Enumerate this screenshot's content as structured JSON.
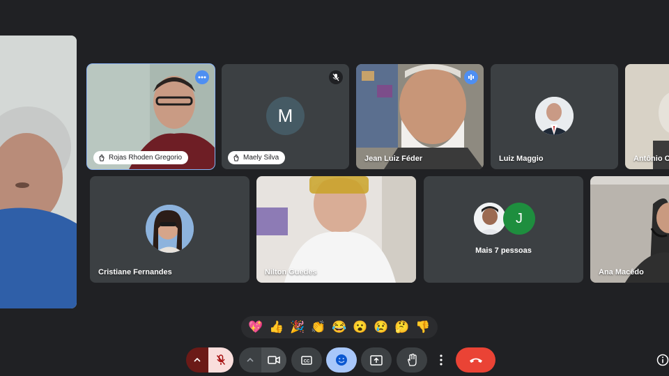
{
  "participants": [
    {
      "id": "main",
      "name": ""
    },
    {
      "id": "rojas",
      "name": "Rojas Rhoden Gregorio"
    },
    {
      "id": "maely",
      "name": "Maely Silva",
      "initial": "M",
      "avatar_color": "#455a64"
    },
    {
      "id": "jean",
      "name": "Jean Luiz Féder"
    },
    {
      "id": "luiz",
      "name": "Luiz Maggio"
    },
    {
      "id": "antonio",
      "name": "Antônio C"
    },
    {
      "id": "cristiane",
      "name": "Cristiane Fernandes"
    },
    {
      "id": "nilton",
      "name": "Nilton Guedes"
    },
    {
      "id": "more",
      "name": "Mais 7 pessoas",
      "initial": "J",
      "avatar_color": "#1e8e3e"
    },
    {
      "id": "ana",
      "name": "Ana Macêdo"
    }
  ],
  "reactions": [
    "💖",
    "👍",
    "🎉",
    "👏",
    "😂",
    "😮",
    "😢",
    "🤔",
    "👎"
  ],
  "colors": {
    "accent": "#8ab4f8",
    "end_call": "#ea4335",
    "mic_off_bg": "#f9dedc",
    "mic_off_icon": "#a50e0e",
    "tile": "#3c4043",
    "background": "#202124"
  },
  "icons": [
    "more-options-icon",
    "mic-off-icon",
    "speaking-icon",
    "chevron-up-icon",
    "camera-icon",
    "captions-icon",
    "emoji-icon",
    "present-icon",
    "raise-hand-icon",
    "more-vert-icon",
    "end-call-icon",
    "info-icon"
  ]
}
